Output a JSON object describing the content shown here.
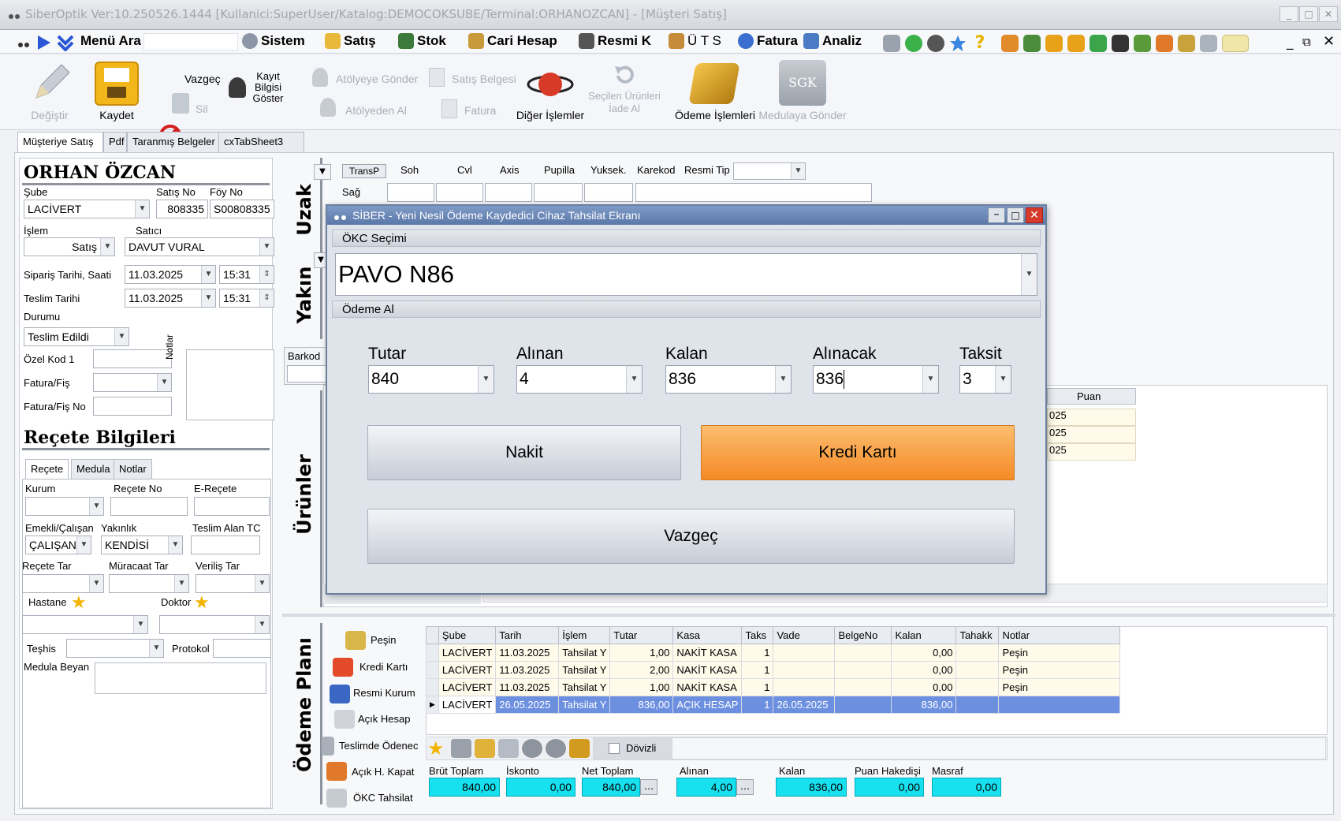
{
  "window": {
    "title": "SiberOptik Ver:10.250526.1444 [Kullanici:SuperUser/Katalog:DEMOCOKSUBE/Terminal:ORHANOZCAN] - [Müşteri Satış]"
  },
  "menu": {
    "menu_search": "Menü Ara",
    "items": [
      "Sistem",
      "Satış",
      "Stok",
      "Cari Hesap",
      "Resmi K",
      "Ü T S",
      "Fatura",
      "Analiz"
    ]
  },
  "ribbon": {
    "degistir": "Değiştir",
    "kaydet": "Kaydet",
    "vazgec": "Vazgeç",
    "sil": "Sil",
    "kayit_bilgisi": "Kayıt Bilgisi Göster",
    "atolyeye_gonder": "Atölyeye Gönder",
    "atolyeden_al": "Atölyeden Al",
    "satis_belgesi": "Satış Belgesi",
    "fatura": "Fatura",
    "diger_islemler": "Diğer İşlemler",
    "secilen_iade": "Seçilen Ürünleri İade Al",
    "odeme_islemleri": "Ödeme İşlemleri",
    "sgk": "SGK",
    "medulaya_gonder": "Medulaya Gönder"
  },
  "tabs": [
    "Müşteriye Satış",
    "Pdf",
    "Taranmış Belgeler",
    "cxTabSheet3"
  ],
  "customer": {
    "name": "ORHAN ÖZCAN",
    "sube_label": "Şube",
    "sube": "LACİVERT",
    "satis_no_label": "Satış No",
    "satis_no": "808335",
    "foy_no_label": "Föy No",
    "foy_no": "S00808335",
    "islem_label": "İşlem",
    "islem": "Satış",
    "satici_label": "Satıcı",
    "satici": "DAVUT VURAL",
    "siparis_label": "Sipariş Tarihi, Saati",
    "siparis_tarih": "11.03.2025",
    "siparis_saat": "15:31",
    "teslim_label": "Teslim Tarihi",
    "teslim_tarih": "11.03.2025",
    "teslim_saat": "15:31",
    "durum_label": "Durumu",
    "durum": "Teslim Edildi",
    "ozel_kod_label": "Özel Kod 1",
    "fatura_fis_label": "Fatura/Fiş",
    "fatura_fis_no_label": "Fatura/Fiş No",
    "notlar_label": "Notlar"
  },
  "recete": {
    "heading": "Reçete Bilgileri",
    "tabs": [
      "Reçete",
      "Medula",
      "Notlar"
    ],
    "kurum": "Kurum",
    "recete_no": "Reçete No",
    "e_recete": "E-Reçete",
    "emekli_label": "Emekli/Çalışan",
    "emekli": "ÇALIŞAN",
    "yakinlik_label": "Yakınlık",
    "yakinlik": "KENDİSİ",
    "teslim_alan": "Teslim Alan TC",
    "recete_tar": "Reçete Tar",
    "muracaat_tar": "Müracaat Tar",
    "verilis_tar": "Veriliş Tar",
    "hastane": "Hastane",
    "doktor": "Doktor",
    "teshis": "Teşhis",
    "protokol": "Protokol",
    "medula_beyan": "Medula Beyan"
  },
  "sections": {
    "uzak": "Uzak",
    "yakin": "Yakın",
    "urunler": "Ürünler",
    "odeme_plani": "Ödeme Planı"
  },
  "lens": {
    "transp": "TransP",
    "cols": [
      "Soh",
      "Cvl",
      "Axis",
      "Pupilla",
      "Yuksek.",
      "Karekod",
      "Resmi Tip"
    ],
    "sag": "Sağ",
    "barkod": "Barkod"
  },
  "products": {
    "puan": "Puan",
    "dates": [
      "025",
      "025",
      "025"
    ]
  },
  "modal": {
    "title": "SİBER - Yeni Nesil Ödeme Kaydedici Cihaz Tahsilat Ekranı",
    "okc_secimi": "ÖKC Seçimi",
    "device": "PAVO N86",
    "odeme_al": "Ödeme Al",
    "fields": [
      {
        "label": "Tutar",
        "value": "840"
      },
      {
        "label": "Alınan",
        "value": "4"
      },
      {
        "label": "Kalan",
        "value": "836"
      },
      {
        "label": "Alınacak",
        "value": "836"
      },
      {
        "label": "Taksit",
        "value": "3"
      }
    ],
    "nakit": "Nakit",
    "kredi_karti": "Kredi Kartı",
    "vazgec": "Vazgeç"
  },
  "payment_side": [
    "Peşin",
    "Kredi Kartı",
    "Resmi Kurum",
    "Açık Hesap",
    "Teslimde Ödenec",
    "Açık H. Kapat",
    "ÖKC Tahsilat"
  ],
  "payment_grid": {
    "columns": [
      "Şube",
      "Tarih",
      "İşlem",
      "Tutar",
      "Kasa",
      "Taks",
      "Vade",
      "BelgeNo",
      "Kalan",
      "Tahakk",
      "Notlar"
    ],
    "rows": [
      [
        "LACİVERT",
        "11.03.2025",
        "Tahsilat Y",
        "1,00",
        "NAKİT KASA",
        "1",
        "",
        "",
        "0,00",
        "",
        "Peşin"
      ],
      [
        "LACİVERT",
        "11.03.2025",
        "Tahsilat Y",
        "2,00",
        "NAKİT KASA",
        "1",
        "",
        "",
        "0,00",
        "",
        "Peşin"
      ],
      [
        "LACİVERT",
        "11.03.2025",
        "Tahsilat Y",
        "1,00",
        "NAKİT KASA",
        "1",
        "",
        "",
        "0,00",
        "",
        "Peşin"
      ],
      [
        "LACİVERT",
        "26.05.2025",
        "Tahsilat Y",
        "836,00",
        "AÇIK HESAP",
        "1",
        "26.05.2025",
        "",
        "836,00",
        "",
        ""
      ]
    ]
  },
  "dovizli": "Dövizli",
  "totals": [
    {
      "label": "Brüt Toplam",
      "value": "840,00"
    },
    {
      "label": "İskonto",
      "value": "0,00"
    },
    {
      "label": "Net Toplam",
      "value": "840,00"
    },
    {
      "label": "Alınan",
      "value": "4,00"
    },
    {
      "label": "Kalan",
      "value": "836,00"
    },
    {
      "label": "Puan Hakedişi",
      "value": "0,00"
    },
    {
      "label": "Masraf",
      "value": "0,00"
    }
  ],
  "colors": {
    "accent_orange": "#f48a26",
    "selection_blue": "#6c8fe0",
    "total_cyan": "#17e0ef"
  }
}
